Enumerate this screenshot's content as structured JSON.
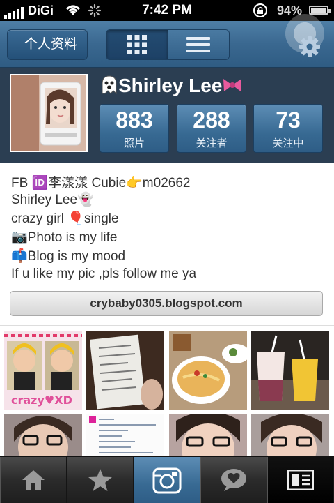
{
  "status_bar": {
    "carrier": "DiGi",
    "time": "7:42 PM",
    "battery": "94%"
  },
  "navbar": {
    "back_label": "个人资料",
    "icons": [
      "grid-view-icon",
      "list-view-icon",
      "gear-icon"
    ]
  },
  "profile": {
    "username": "Shirley Lee",
    "stats": [
      {
        "value": "883",
        "label": "照片"
      },
      {
        "value": "288",
        "label": "关注者"
      },
      {
        "value": "73",
        "label": "关注中"
      }
    ]
  },
  "bio": {
    "lines": [
      "FB 🆔李漾漾 Cubie👉m02662",
      "Shirley Lee👻",
      "crazy girl 🎈single",
      "📷Photo is my life",
      "📫Blog is my mood",
      "If u like my pic ,pls follow me ya"
    ],
    "website": "crybaby0305.blogspot.com"
  },
  "tabbar": {
    "items": [
      "home-icon",
      "star-icon",
      "camera-icon",
      "speech-heart-icon",
      "news-icon"
    ]
  },
  "colors": {
    "accent_blue": "#386a93",
    "profile_bg": "#2b3e52"
  }
}
